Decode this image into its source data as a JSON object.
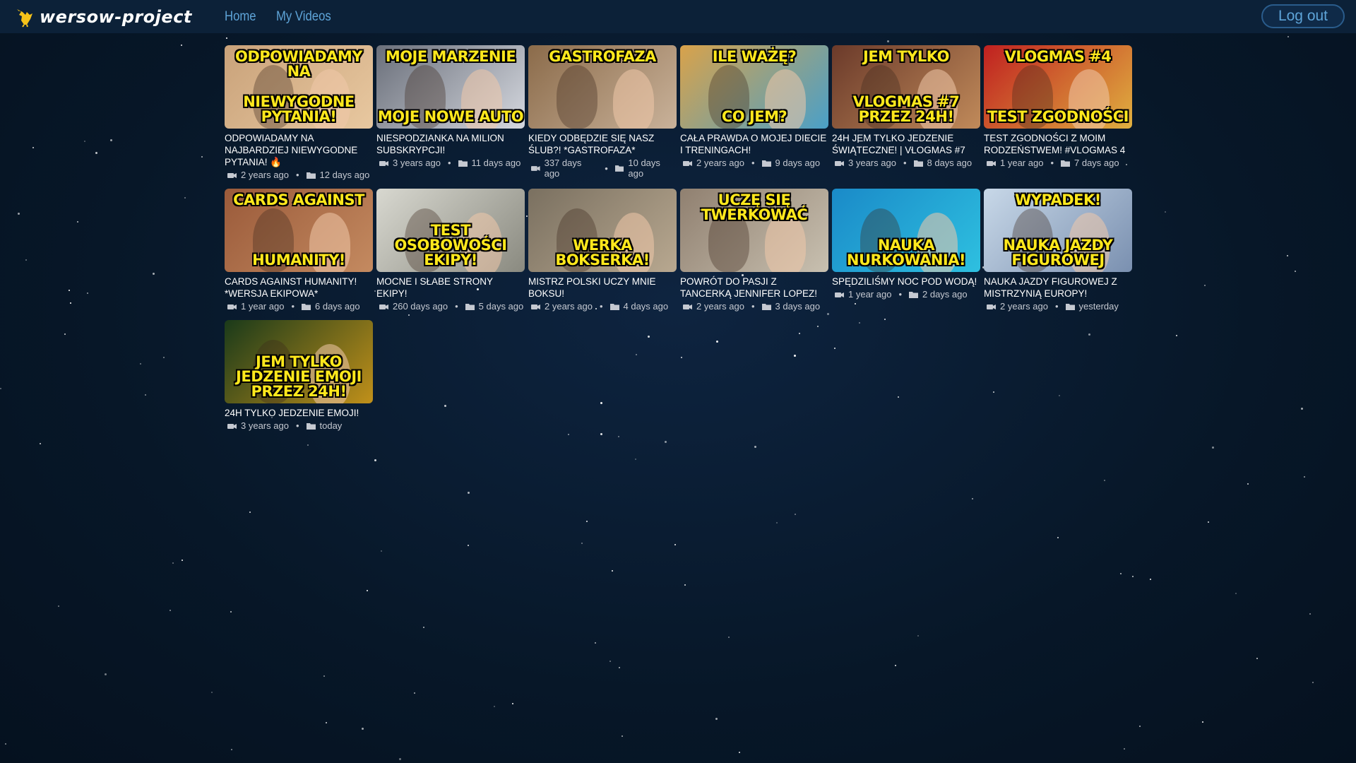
{
  "app": {
    "name": "wersow-project"
  },
  "nav": {
    "home": "Home",
    "my_videos": "My Videos"
  },
  "logout_label": "Log out",
  "colors": {
    "topbar": "#0c2138",
    "nav_link": "#5ea4d8",
    "background": "#071728",
    "thumb_text": "#ffe81c"
  },
  "videos": [
    {
      "title": "ODPOWIADAMY NA NAJBARDZIEJ NIEWYGODNE PYTANIA! 🔥",
      "uploaded": "2 years ago",
      "added": "12 days ago",
      "thumb_top": "ODPOWIADAMY NA",
      "thumb_bottom": "NIEWYGODNE PYTANIA!"
    },
    {
      "title": "NIESPODZIANKA NA MILION SUBSKRYPCJI!",
      "uploaded": "3 years ago",
      "added": "11 days ago",
      "thumb_top": "MOJE MARZENIE",
      "thumb_bottom": "MOJE NOWE AUTO"
    },
    {
      "title": "KIEDY ODBĘDZIE SIĘ NASZ ŚLUB?! *GASTROFAZA*",
      "uploaded": "337 days ago",
      "added": "10 days ago",
      "thumb_top": "GASTROFAZA",
      "thumb_bottom": ""
    },
    {
      "title": "CAŁA PRAWDA O MOJEJ DIECIE I TRENINGACH!",
      "uploaded": "2 years ago",
      "added": "9 days ago",
      "thumb_top": "ILE WAŻĘ?",
      "thumb_bottom": "CO JEM?"
    },
    {
      "title": "24H JEM TYLKO JEDZENIE ŚWIĄTECZNE! | VLOGMAS #7",
      "uploaded": "3 years ago",
      "added": "8 days ago",
      "thumb_top": "JEM TYLKO",
      "thumb_bottom": "VLOGMAS #7 PRZEZ 24H!"
    },
    {
      "title": "TEST ZGODNOŚCI Z MOIM RODZEŃSTWEM! #VLOGMAS 4",
      "uploaded": "1 year ago",
      "added": "7 days ago",
      "thumb_top": "VLOGMAS #4",
      "thumb_bottom": "TEST ZGODNOŚCI"
    },
    {
      "title": "CARDS AGAINST HUMANITY! *WERSJA EKIPOWA*",
      "uploaded": "1 year ago",
      "added": "6 days ago",
      "thumb_top": "CARDS AGAINST",
      "thumb_bottom": "HUMANITY!"
    },
    {
      "title": "MOCNE I SŁABE STRONY EKIPY!",
      "uploaded": "260 days ago",
      "added": "5 days ago",
      "thumb_top": "",
      "thumb_bottom": "TEST OSOBOWOŚCI EKIPY!"
    },
    {
      "title": "MISTRZ POLSKI UCZY MNIE BOKSU!",
      "uploaded": "2 years ago",
      "added": "4 days ago",
      "thumb_top": "",
      "thumb_bottom": "WERKA BOKSERKA!"
    },
    {
      "title": "POWRÓT DO PASJI Z TANCERKĄ JENNIFER LOPEZ!",
      "uploaded": "2 years ago",
      "added": "3 days ago",
      "thumb_top": "UCZĘ SIĘ TWERKOWAĆ",
      "thumb_bottom": ""
    },
    {
      "title": "SPĘDZILIŚMY NOC POD WODĄ!",
      "uploaded": "1 year ago",
      "added": "2 days ago",
      "thumb_top": "",
      "thumb_bottom": "NAUKA NURKOWANIA!"
    },
    {
      "title": "NAUKA JAZDY FIGUROWEJ Z MISTRZYNIĄ EUROPY!",
      "uploaded": "2 years ago",
      "added": "yesterday",
      "thumb_top": "WYPADEK!",
      "thumb_bottom": "NAUKA JAZDY FIGUROWEJ"
    },
    {
      "title": "24H TYLKO JEDZENIE EMOJI!",
      "uploaded": "3 years ago",
      "added": "today",
      "thumb_top": "",
      "thumb_bottom": "JEM TYLKO JEDZENIE EMOJI PRZEZ 24H!"
    }
  ]
}
